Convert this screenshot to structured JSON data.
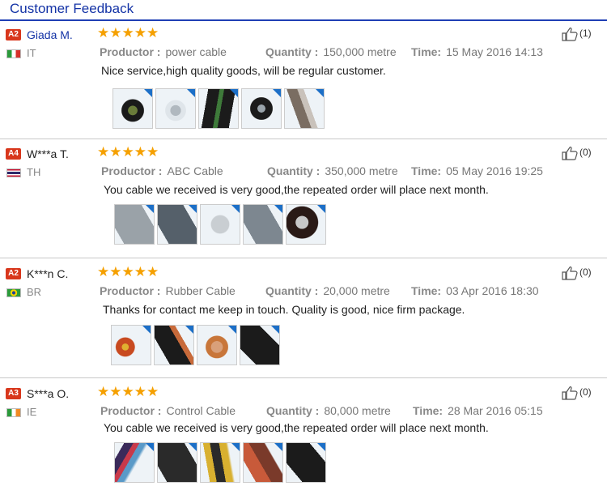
{
  "header": {
    "title": "Customer Feedback"
  },
  "colors": {
    "accent": "#1f3fb5",
    "badge": "#d8371c",
    "star": "#f5a000"
  },
  "labels": {
    "productor": "Productor :",
    "quantity": "Quantity :",
    "time": "Time:",
    "stars": "★★★★★"
  },
  "reviews": [
    {
      "badge": "A2",
      "name": "Giada M.",
      "country": "IT",
      "flag_icon": "flag-italy-icon",
      "product": "power cable",
      "quantity": "150,000 metre",
      "time": "15 May 2016  14:13",
      "comment": "Nice service,high quality goods, will be regular customer.",
      "likes": "(1)",
      "rating": 5,
      "images": [
        "cable-thumbnail-1",
        "cable-thumbnail-2",
        "cable-thumbnail-3",
        "cable-thumbnail-4",
        "cable-thumbnail-5"
      ]
    },
    {
      "badge": "A4",
      "name": "W***a T.",
      "country": "TH",
      "flag_icon": "flag-thailand-icon",
      "product": "ABC Cable",
      "quantity": "350,000 metre",
      "time": "05 May 2016  19:25",
      "comment": "You cable we received is very good,the repeated order will place next month.",
      "likes": "(0)",
      "rating": 5,
      "images": [
        "cable-thumbnail-1",
        "cable-thumbnail-2",
        "cable-thumbnail-3",
        "cable-thumbnail-4",
        "cable-thumbnail-5"
      ]
    },
    {
      "badge": "A2",
      "name": "K***n C.",
      "country": "BR",
      "flag_icon": "flag-brazil-icon",
      "product": "Rubber Cable",
      "quantity": "20,000 metre",
      "time": "03 Apr 2016  18:30",
      "comment": "Thanks for contact me keep in touch. Quality is good, nice firm package.",
      "likes": "(0)",
      "rating": 5,
      "images": [
        "cable-thumbnail-1",
        "cable-thumbnail-2",
        "cable-thumbnail-3",
        "cable-thumbnail-4"
      ]
    },
    {
      "badge": "A3",
      "name": "S***a O.",
      "country": "IE",
      "flag_icon": "flag-ireland-icon",
      "product": "Control Cable",
      "quantity": "80,000 metre",
      "time": "28 Mar 2016  05:15",
      "comment": "You cable we received is very good,the repeated order will place next month.",
      "likes": "(0)",
      "rating": 5,
      "images": [
        "cable-thumbnail-1",
        "cable-thumbnail-2",
        "cable-thumbnail-3",
        "cable-thumbnail-4",
        "cable-thumbnail-5"
      ]
    }
  ]
}
